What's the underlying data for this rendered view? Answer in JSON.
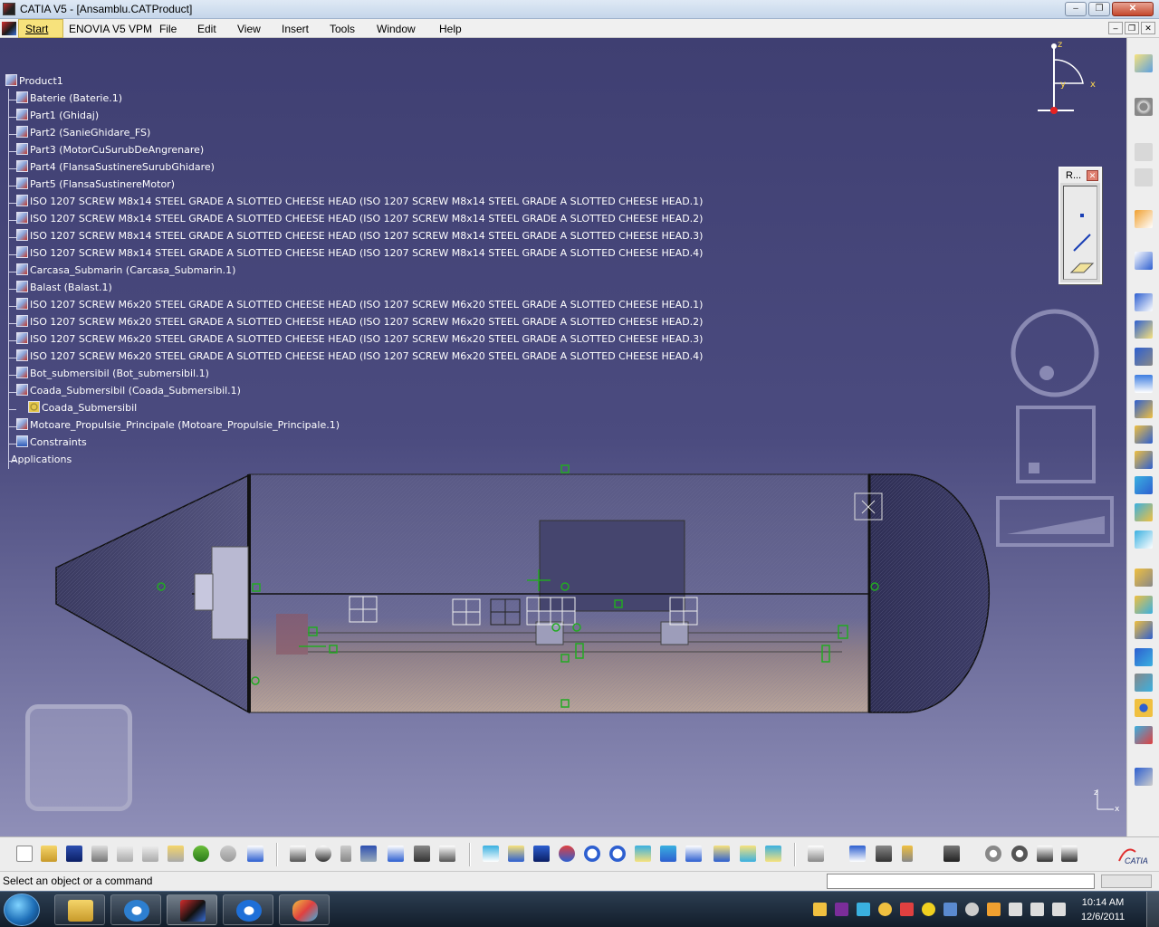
{
  "window": {
    "title": "CATIA V5 - [Ansamblu.CATProduct]",
    "minimize": "–",
    "restore": "❐",
    "close": "✕"
  },
  "menu": {
    "start": "Start",
    "items": [
      "ENOVIA V5 VPM",
      "File",
      "Edit",
      "View",
      "Insert",
      "Tools",
      "Window",
      "Help"
    ],
    "mdi_minimize": "–",
    "mdi_restore": "❐",
    "mdi_close": "✕"
  },
  "tree": {
    "items": [
      {
        "label": "Product1",
        "icon": "product-icon"
      },
      {
        "label": "Baterie (Baterie.1)",
        "icon": "part-icon"
      },
      {
        "label": "Part1 (Ghidaj)",
        "icon": "part-icon"
      },
      {
        "label": "Part2 (SanieGhidare_FS)",
        "icon": "part-icon"
      },
      {
        "label": "Part3 (MotorCuSurubDeAngrenare)",
        "icon": "part-icon"
      },
      {
        "label": "Part4 (FlansaSustinereSurubGhidare)",
        "icon": "part-icon"
      },
      {
        "label": "Part5 (FlansaSustinereMotor)",
        "icon": "part-icon"
      },
      {
        "label": "ISO 1207 SCREW M8x14 STEEL GRADE A SLOTTED CHEESE HEAD (ISO 1207 SCREW M8x14 STEEL GRADE A SLOTTED CHEESE HEAD.1)",
        "icon": "part-icon"
      },
      {
        "label": "ISO 1207 SCREW M8x14 STEEL GRADE A SLOTTED CHEESE HEAD (ISO 1207 SCREW M8x14 STEEL GRADE A SLOTTED CHEESE HEAD.2)",
        "icon": "part-icon"
      },
      {
        "label": "ISO 1207 SCREW M8x14 STEEL GRADE A SLOTTED CHEESE HEAD (ISO 1207 SCREW M8x14 STEEL GRADE A SLOTTED CHEESE HEAD.3)",
        "icon": "part-icon"
      },
      {
        "label": "ISO 1207 SCREW M8x14 STEEL GRADE A SLOTTED CHEESE HEAD (ISO 1207 SCREW M8x14 STEEL GRADE A SLOTTED CHEESE HEAD.4)",
        "icon": "part-icon"
      },
      {
        "label": "Carcasa_Submarin (Carcasa_Submarin.1)",
        "icon": "part-icon"
      },
      {
        "label": "Balast (Balast.1)",
        "icon": "part-icon"
      },
      {
        "label": "ISO 1207 SCREW M6x20 STEEL GRADE A SLOTTED CHEESE HEAD (ISO 1207 SCREW M6x20 STEEL GRADE A SLOTTED CHEESE HEAD.1)",
        "icon": "part-icon"
      },
      {
        "label": "ISO 1207 SCREW M6x20 STEEL GRADE A SLOTTED CHEESE HEAD (ISO 1207 SCREW M6x20 STEEL GRADE A SLOTTED CHEESE HEAD.2)",
        "icon": "part-icon"
      },
      {
        "label": "ISO 1207 SCREW M6x20 STEEL GRADE A SLOTTED CHEESE HEAD (ISO 1207 SCREW M6x20 STEEL GRADE A SLOTTED CHEESE HEAD.3)",
        "icon": "part-icon"
      },
      {
        "label": "ISO 1207 SCREW M6x20 STEEL GRADE A SLOTTED CHEESE HEAD (ISO 1207 SCREW M6x20 STEEL GRADE A SLOTTED CHEESE HEAD.4)",
        "icon": "part-icon"
      },
      {
        "label": "Bot_submersibil (Bot_submersibil.1)",
        "icon": "part-icon"
      },
      {
        "label": "Coada_Submersibil (Coada_Submersibil.1)",
        "icon": "part-icon"
      },
      {
        "label": "Coada_Submersibil",
        "icon": "gear-icon"
      },
      {
        "label": "Motoare_Propulsie_Principale (Motoare_Propulsie_Principale.1)",
        "icon": "part-icon"
      },
      {
        "label": "Constraints",
        "icon": "constraints-icon"
      },
      {
        "label": "Applications",
        "icon": "applications-icon"
      }
    ]
  },
  "compass": {
    "x": "x",
    "y": "y",
    "z": "z"
  },
  "palette": {
    "title": "R...",
    "close": "✕"
  },
  "axis_corner": {
    "z": "z",
    "x": "x"
  },
  "status": {
    "message": "Select an object or a command",
    "command_value": ""
  },
  "taskbar": {
    "time": "10:14 AM",
    "date": "12/6/2011"
  },
  "colors": {
    "viewport_top": "#3f3f72",
    "viewport_bottom": "#8f8fb8",
    "accent": "#f7e27c"
  }
}
